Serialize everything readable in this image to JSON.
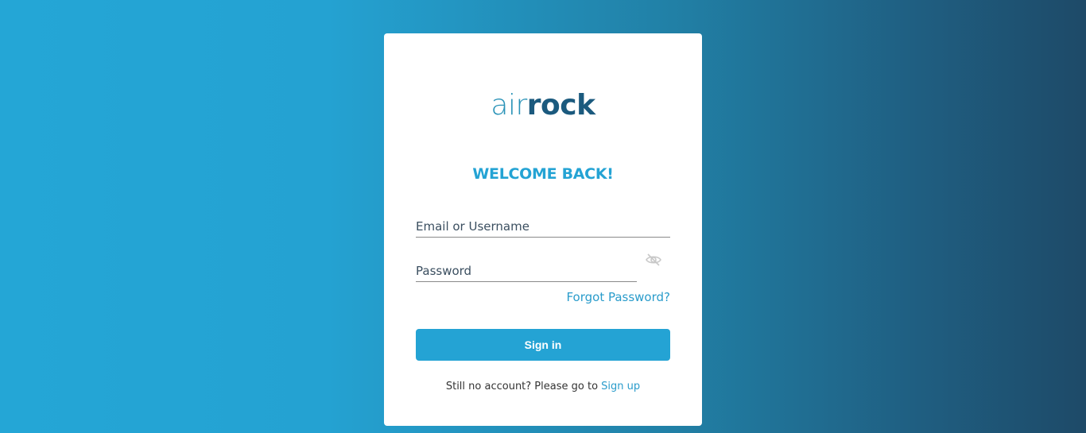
{
  "logo": {
    "light": "air",
    "bold": "rock"
  },
  "welcome": "WELCOME BACK!",
  "email": {
    "placeholder": "Email or Username",
    "value": ""
  },
  "password": {
    "placeholder": "Password",
    "value": ""
  },
  "forgot_password": "Forgot Password?",
  "signin_label": "Sign in",
  "signup": {
    "prompt": "Still no account? Please go to",
    "link": "Sign up"
  },
  "icons": {
    "password_visibility": "eye-off-icon"
  },
  "colors": {
    "accent": "#24a3d4",
    "logo_light": "#2a93b8",
    "logo_bold": "#1b5a7e",
    "gradient_start": "#24a6d6",
    "gradient_end": "#1e4a68"
  }
}
